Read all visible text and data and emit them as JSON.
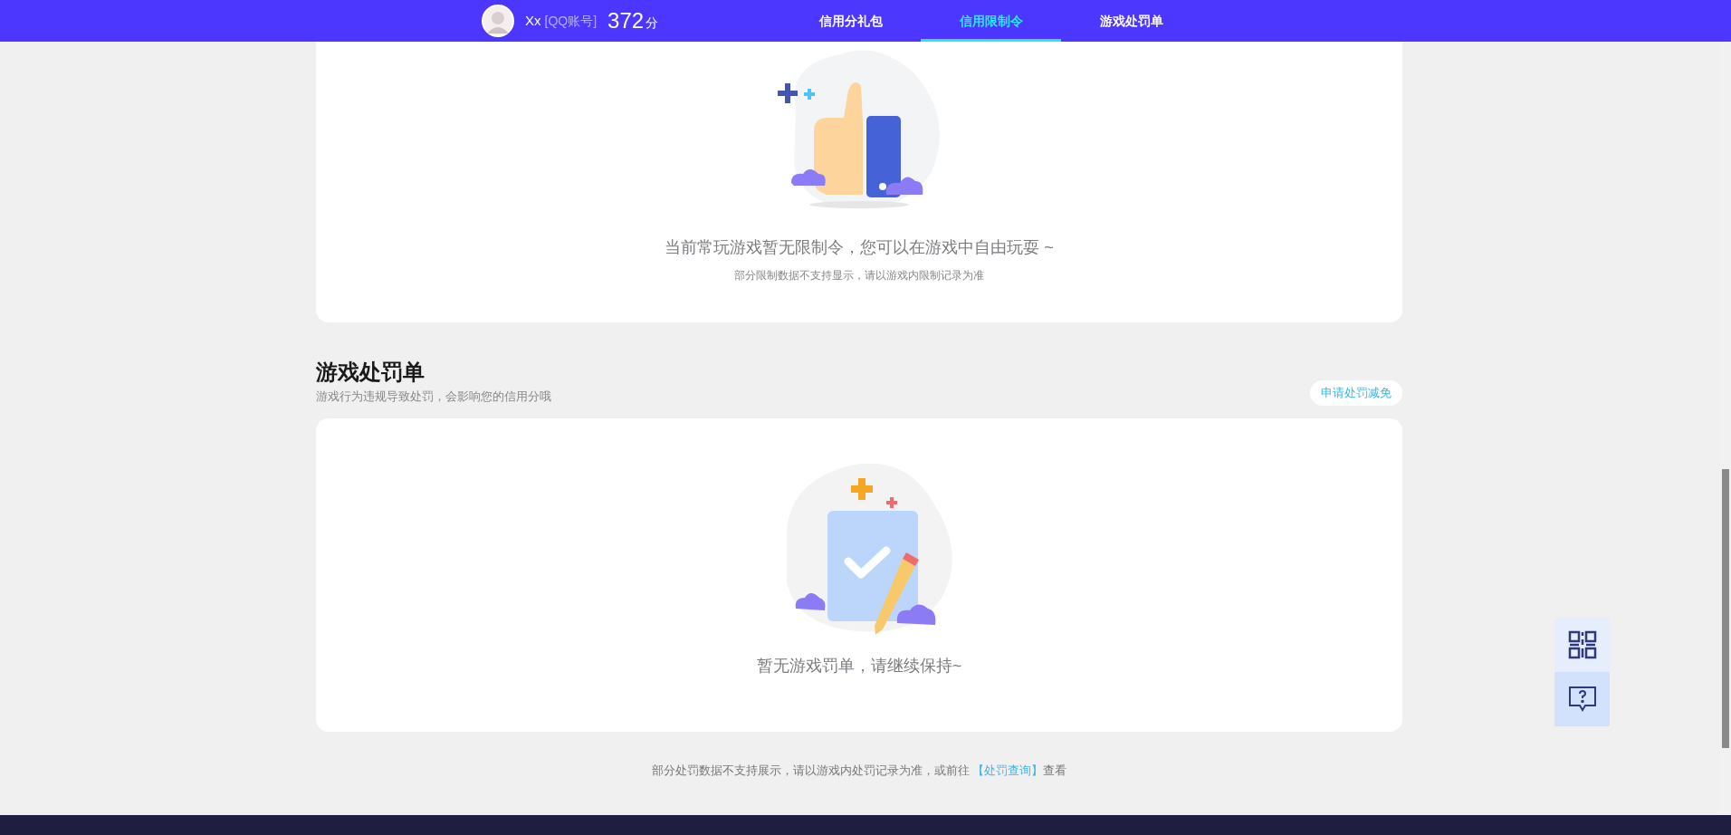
{
  "header": {
    "username": "Xx",
    "account_label": "[QQ账号]",
    "score": "372",
    "score_unit": "分"
  },
  "tabs": [
    {
      "label": "信用分礼包",
      "selected": false
    },
    {
      "label": "信用限制令",
      "selected": true
    },
    {
      "label": "游戏处罚单",
      "selected": false
    }
  ],
  "restriction_card": {
    "message": "当前常玩游戏暂无限制令，您可以在游戏中自由玩耍 ~",
    "note": "部分限制数据不支持显示，请以游戏内限制记录为准"
  },
  "penalty_section": {
    "title": "游戏处罚单",
    "subtitle": "游戏行为违规导致处罚，会影响您的信用分哦",
    "appeal_button": "申请处罚减免",
    "message": "暂无游戏罚单，请继续保持~"
  },
  "footer_note": {
    "text_before": "部分处罚数据不支持展示，请以游戏内处罚记录为准，或前往 ",
    "link": "【处罚查询】",
    "text_after": "查看"
  }
}
